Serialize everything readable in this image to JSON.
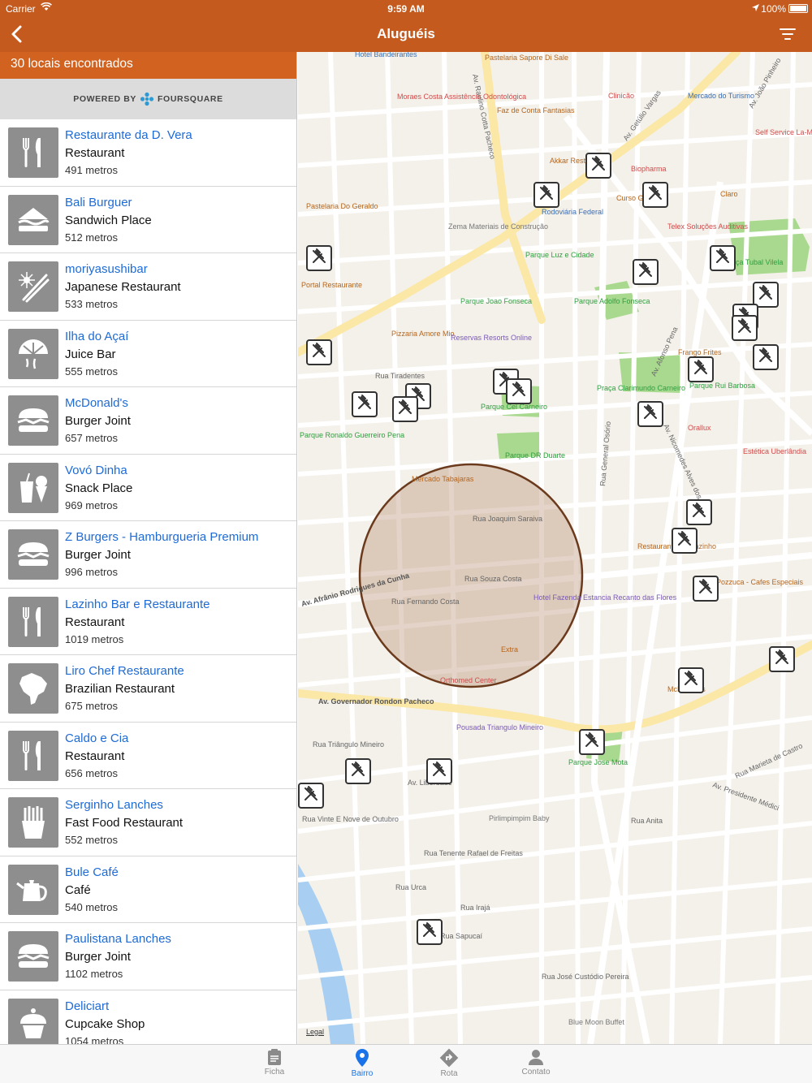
{
  "status": {
    "carrier": "Carrier",
    "time": "9:59 AM",
    "battery": "100%"
  },
  "nav": {
    "title": "Aluguéis"
  },
  "results": {
    "count_text": "30 locais encontrados"
  },
  "powered": {
    "prefix": "POWERED BY",
    "brand": "FOURSQUARE"
  },
  "venues": [
    {
      "name": "Restaurante da  D. Vera",
      "category": "Restaurant",
      "distance": "491 metros",
      "icon": "fork-knife-icon"
    },
    {
      "name": "Bali Burguer",
      "category": "Sandwich Place",
      "distance": "512 metros",
      "icon": "sandwich-icon"
    },
    {
      "name": "moriyasushibar",
      "category": "Japanese Restaurant",
      "distance": "533 metros",
      "icon": "chopsticks-icon"
    },
    {
      "name": "Ilha do Açaí",
      "category": "Juice Bar",
      "distance": "555 metros",
      "icon": "juice-icon"
    },
    {
      "name": "McDonald's",
      "category": "Burger Joint",
      "distance": "657 metros",
      "icon": "burger-icon"
    },
    {
      "name": "Vovó Dinha",
      "category": "Snack Place",
      "distance": "969 metros",
      "icon": "snack-icon"
    },
    {
      "name": "Z Burgers - Hamburgueria Premium",
      "category": "Burger Joint",
      "distance": "996 metros",
      "icon": "burger-icon"
    },
    {
      "name": "Lazinho Bar e Restaurante",
      "category": "Restaurant",
      "distance": "1019 metros",
      "icon": "fork-knife-icon"
    },
    {
      "name": "Liro Chef Restaurante",
      "category": "Brazilian Restaurant",
      "distance": "675 metros",
      "icon": "brazil-map-icon"
    },
    {
      "name": "Caldo e Cia",
      "category": "Restaurant",
      "distance": "656 metros",
      "icon": "fork-knife-icon"
    },
    {
      "name": "Serginho Lanches",
      "category": "Fast Food Restaurant",
      "distance": "552 metros",
      "icon": "fries-icon"
    },
    {
      "name": "Bule Café",
      "category": "Café",
      "distance": "540 metros",
      "icon": "teapot-icon"
    },
    {
      "name": "Paulistana Lanches",
      "category": "Burger Joint",
      "distance": "1102 metros",
      "icon": "burger-icon"
    },
    {
      "name": "Deliciart",
      "category": "Cupcake Shop",
      "distance": "1054 metros",
      "icon": "cupcake-icon"
    }
  ],
  "map": {
    "legal": "Legal",
    "labels": [
      "Av. Raulino Cotta Pacheco",
      "Av. Getúlio Vargas",
      "Av. João Pinheiro",
      "Av. Afonso Pena",
      "Rua General Osório",
      "Av. Nicomedes Alves dos Santos",
      "Av. Afrânio Rodrigues da Cunha",
      "Av. Governador Rondon Pacheco",
      "Rua Tiradentes",
      "Rua Joaquim Saraiva",
      "Rua Souza Costa",
      "Rua Fernando Costa",
      "Av. Presidente Médici",
      "Rua Anita",
      "Rua Tenente Rafael de Freitas",
      "Rua Urca",
      "Rua Irajá",
      "Rua Sapucaí",
      "Rua José Custódio Pereira",
      "Rua Vinte E Nove de Outubro",
      "Rua Triângulo Mineiro",
      "Av. Liberdade",
      "Rua Marieta de Castro",
      "Parque Luz e Cidade",
      "Parque Joao Fonseca",
      "Parque Adolfo Fonseca",
      "Praça Clarimundo Carneiro",
      "Parque Rui Barbosa",
      "Parque Cel Carneiro",
      "Parque DR Duarte",
      "Parque Ronaldo Guerreiro Pena",
      "Parque Jose Mota",
      "Praça Tubal Vilela",
      "Mercado Tabajaras",
      "Hotel Fazenda Estancia Recanto das Flores",
      "Extra",
      "Orthomed Center",
      "Pousada Triangulo Mineiro",
      "Pirlimpimpim Baby",
      "Blue Moon Buffet",
      "Mercado do Turismo",
      "Rodoviária Federal",
      "Biopharma",
      "Clinicão",
      "Zema Materiais de Construção",
      "Pastelaria Sapore Di Sale",
      "Moraes Costa Assistência Odontológica",
      "Faz de Conta Fantasias",
      "Akkar Restaurante",
      "Curso Gabarito",
      "Telex Soluções Auditivas",
      "Claro",
      "Self Service La-Mama",
      "Portal Restaurante",
      "Pizzaria Amore Mio",
      "Reservas Resorts Online",
      "Frango Frites",
      "Orallux",
      "Estética Uberlândia",
      "Restaurante Do Lazinho",
      "Pozzuca - Cafes Especiais",
      "McDonald's",
      "Hotel Bandeirantes",
      "Pastelaria Do Geraldo"
    ]
  },
  "tabs": [
    {
      "label": "Ficha",
      "icon": "clipboard-icon"
    },
    {
      "label": "Bairro",
      "icon": "location-pin-icon"
    },
    {
      "label": "Rota",
      "icon": "route-arrow-icon"
    },
    {
      "label": "Contato",
      "icon": "person-icon"
    }
  ],
  "colors": {
    "nav": "#C45A1E",
    "count_bar": "#D2621F",
    "link": "#1E6BD6",
    "tab_active": "#1A73E8"
  }
}
